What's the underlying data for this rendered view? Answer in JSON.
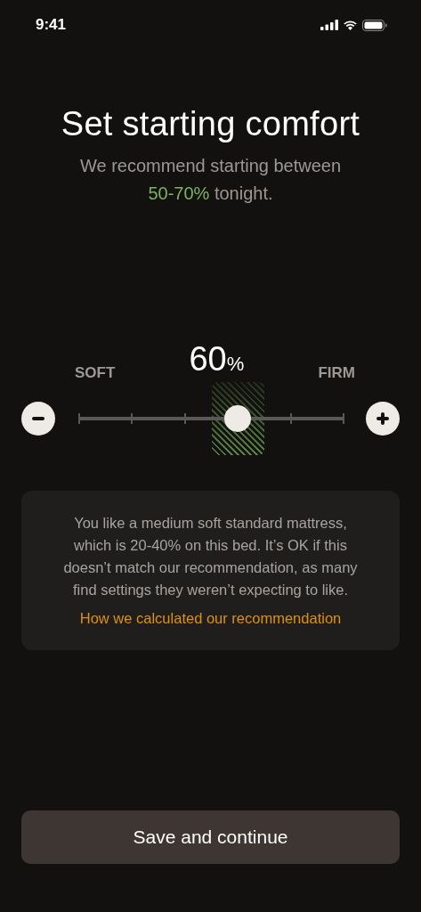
{
  "status_bar": {
    "time": "9:41"
  },
  "title": "Set starting comfort",
  "subtitle": {
    "text": "We recommend starting between",
    "highlight": "50-70%",
    "after": "tonight."
  },
  "slider": {
    "value": "60",
    "unit": "%",
    "min_label": "SOFT",
    "max_label": "FIRM",
    "level": 0.6
  },
  "info_card": {
    "text": "You like a medium soft standard mattress, which is 20-40% on this bed. It’s OK if this doesn’t match our recommendation, as many find settings they weren’t expecting to like.",
    "link": "How we calculated our recommendation"
  },
  "button": "Save and continue"
}
